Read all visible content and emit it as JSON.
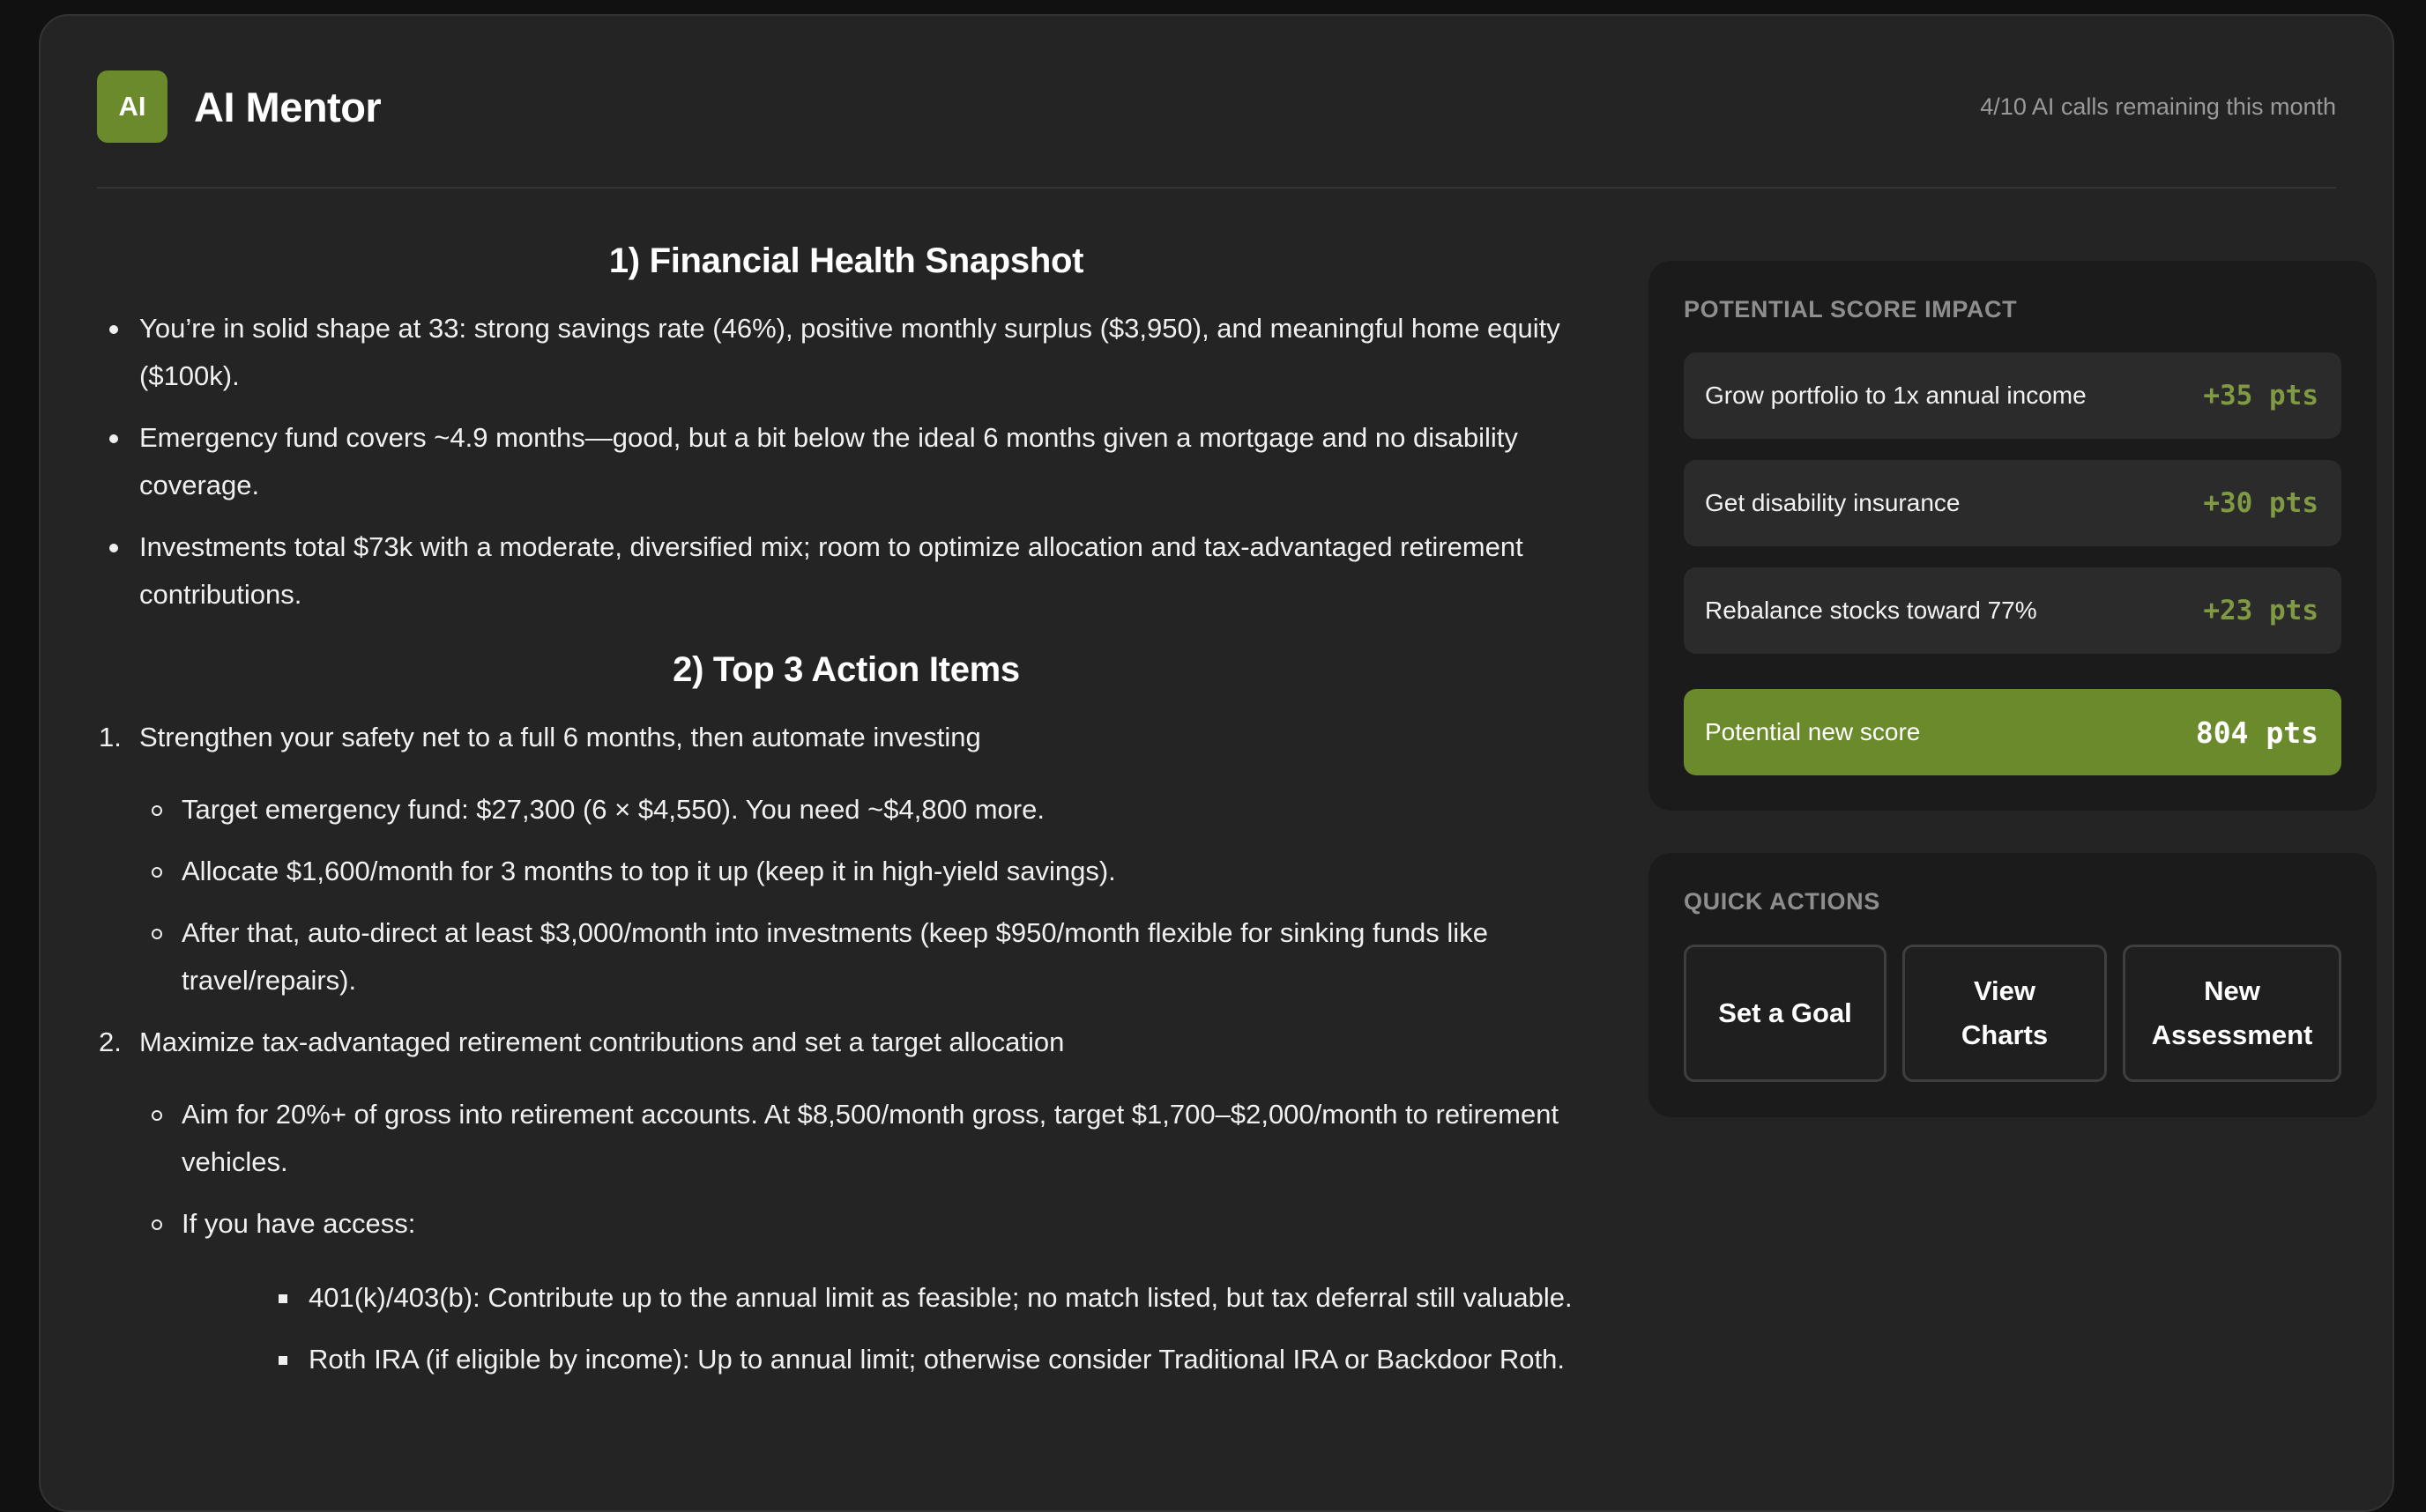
{
  "header": {
    "logo_text": "AI",
    "title": "AI Mentor",
    "calls_remaining": "4/10 AI calls remaining this month"
  },
  "main": {
    "section1": {
      "heading": "1) Financial Health Snapshot",
      "bullets": [
        "You’re in solid shape at 33: strong savings rate (46%), positive monthly surplus ($3,950), and meaningful home equity ($100k).",
        "Emergency fund covers ~4.9 months—good, but a bit below the ideal 6 months given a mortgage and no disability coverage.",
        "Investments total $73k with a moderate, diversified mix; room to optimize allocation and tax-advantaged retirement contributions."
      ]
    },
    "section2": {
      "heading": "2) Top 3 Action Items",
      "items": [
        {
          "num": "1.",
          "title": "Strengthen your safety net to a full 6 months, then automate investing",
          "subs": [
            "Target emergency fund: $27,300 (6 × $4,550). You need ~$4,800 more.",
            "Allocate $1,600/month for 3 months to top it up (keep it in high-yield savings).",
            "After that, auto-direct at least $3,000/month into investments (keep $950/month flexible for sinking funds like travel/repairs)."
          ]
        },
        {
          "num": "2.",
          "title": "Maximize tax-advantaged retirement contributions and set a target allocation",
          "subs": [
            "Aim for 20%+ of gross into retirement accounts. At $8,500/month gross, target $1,700–$2,000/month to retirement vehicles.",
            "If you have access:"
          ],
          "subsubs": [
            "401(k)/403(b): Contribute up to the annual limit as feasible; no match listed, but tax deferral still valuable.",
            "Roth IRA (if eligible by income): Up to annual limit; otherwise consider Traditional IRA or Backdoor Roth."
          ]
        }
      ]
    }
  },
  "impact": {
    "label": "POTENTIAL SCORE IMPACT",
    "rows": [
      {
        "label": "Grow portfolio to 1x annual income",
        "pts": "+35 pts"
      },
      {
        "label": "Get disability insurance",
        "pts": "+30 pts"
      },
      {
        "label": "Rebalance stocks toward 77%",
        "pts": "+23 pts"
      }
    ],
    "new_score_label": "Potential new score",
    "new_score_value": "804 pts"
  },
  "quick_actions": {
    "label": "QUICK ACTIONS",
    "set_goal": "Set a Goal",
    "view_charts_1": "View",
    "view_charts_2": "Charts",
    "new_assessment_1": "New",
    "new_assessment_2": "Assessment"
  },
  "colors": {
    "accent": "#6b8a2c",
    "points": "#7f9a42",
    "panel": "#242424",
    "card": "#1b1b1b"
  }
}
